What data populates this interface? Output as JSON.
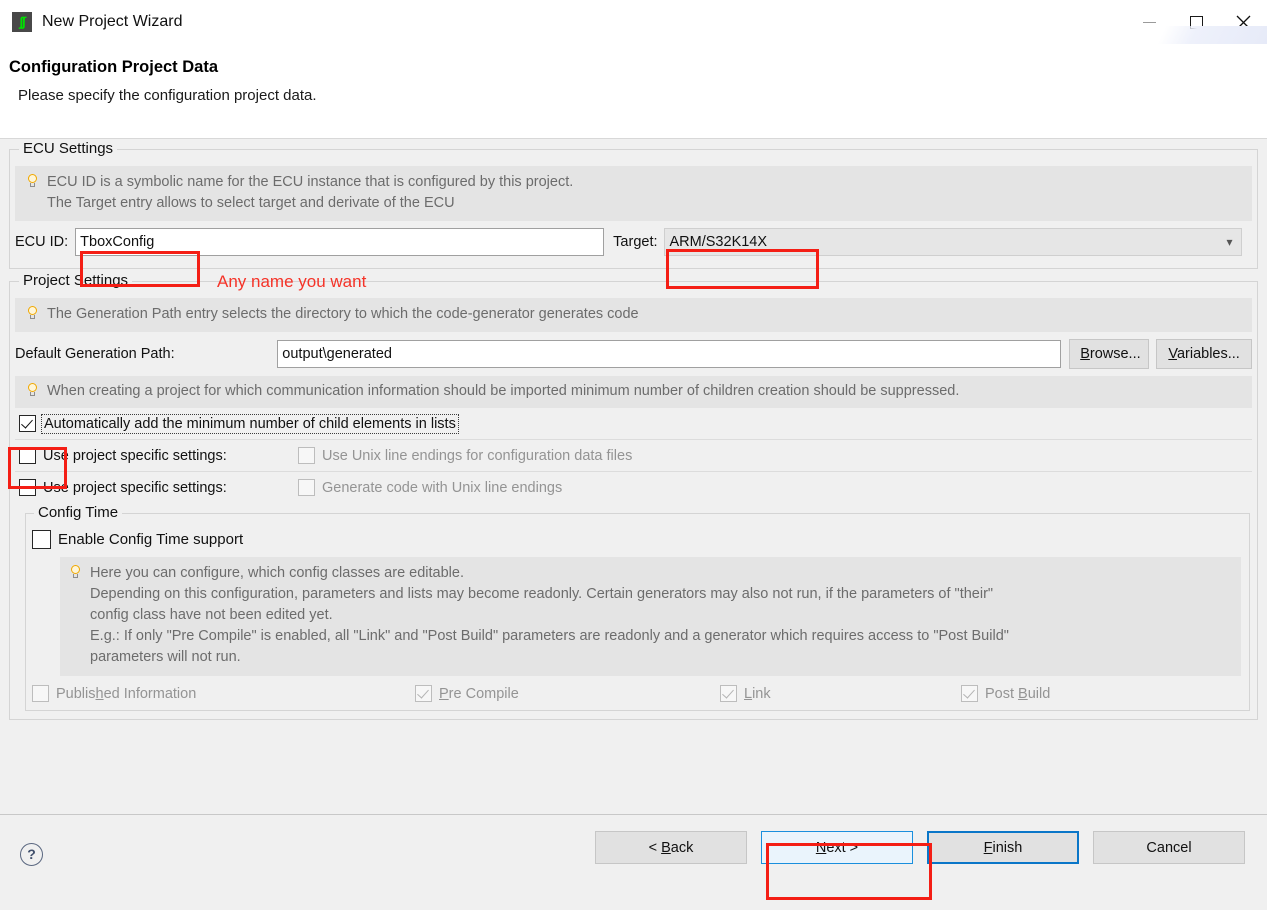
{
  "window": {
    "title": "New Project Wizard",
    "icon": "eb-logo-icon",
    "minimize_label": "minimize-icon",
    "maximize_label": "maximize-icon",
    "close_label": "close-icon"
  },
  "header": {
    "title": "Configuration Project Data",
    "subtitle": "Please specify the configuration project data."
  },
  "ecu_settings": {
    "group_title": "ECU Settings",
    "hint_line1": "ECU ID is a symbolic name for the ECU instance that is configured by this project.",
    "hint_line2": "The Target entry allows to select target and derivate of the ECU",
    "ecu_id_label": "ECU ID:",
    "ecu_id_value": "TboxConfig",
    "ecu_id_placeholder": "",
    "target_label": "Target:",
    "target_value": "ARM/S32K14X"
  },
  "project_settings": {
    "group_title": "Project Settings",
    "hint": "The Generation Path entry selects the directory to which the code-generator generates code",
    "path_label": "Default Generation Path:",
    "path_value": "output\\generated",
    "browse_label": "Browse...",
    "browse_mnemonic": "B",
    "variables_label": "Variables...",
    "variables_mnemonic": "V",
    "children_hint": "When creating a project for which communication information should be imported minimum number of children creation should be suppressed.",
    "checkboxes": [
      {
        "label": "Automatically add the minimum number of child elements in lists",
        "checked": true,
        "enabled": true,
        "focused": true
      },
      {
        "label": "Use project specific settings:",
        "checked": false,
        "enabled": true,
        "sub_label": "Use Unix line endings for configuration data files",
        "sub_checked": false,
        "sub_enabled": false
      },
      {
        "label": "Use project specific settings:",
        "checked": false,
        "enabled": true,
        "sub_label": "Generate code with Unix line endings",
        "sub_checked": false,
        "sub_enabled": false
      }
    ]
  },
  "config_time": {
    "group_title": "Config Time",
    "enable_label": "Enable Config Time support",
    "enable_checked": false,
    "hint_lines": [
      "Here you can configure, which config classes are editable.",
      "Depending on this configuration, parameters and lists may become readonly. Certain generators may also not run, if the parameters of \"their\"",
      "config class have not been edited yet.",
      "E.g.: If only \"Pre Compile\" is enabled, all \"Link\" and \"Post Build\" parameters are readonly and a generator which requires access to \"Post Build\"",
      "parameters will not run."
    ],
    "class_checkboxes": [
      {
        "label_pre": "Publis",
        "label_mn": "h",
        "label_post": "ed Information",
        "checked": false,
        "enabled": false
      },
      {
        "label_pre": "",
        "label_mn": "P",
        "label_post": "re Compile",
        "checked": true,
        "enabled": false
      },
      {
        "label_pre": "",
        "label_mn": "L",
        "label_post": "ink",
        "checked": true,
        "enabled": false
      },
      {
        "label_pre": "Post ",
        "label_mn": "B",
        "label_post": "uild",
        "checked": true,
        "enabled": false
      }
    ]
  },
  "footer": {
    "help_glyph": "?",
    "buttons": [
      {
        "name": "back",
        "pre": "< ",
        "mn": "B",
        "post": "ack",
        "state": "normal"
      },
      {
        "name": "next",
        "pre": "",
        "mn": "N",
        "post": "ext >",
        "state": "hover"
      },
      {
        "name": "finish",
        "pre": "",
        "mn": "F",
        "post": "inish",
        "state": "default"
      },
      {
        "name": "cancel",
        "pre": "Cancel",
        "mn": "",
        "post": "",
        "state": "normal"
      }
    ]
  },
  "annotations": {
    "ecu_id_note": "Any name you want",
    "highlight_color": "#f41e15"
  }
}
